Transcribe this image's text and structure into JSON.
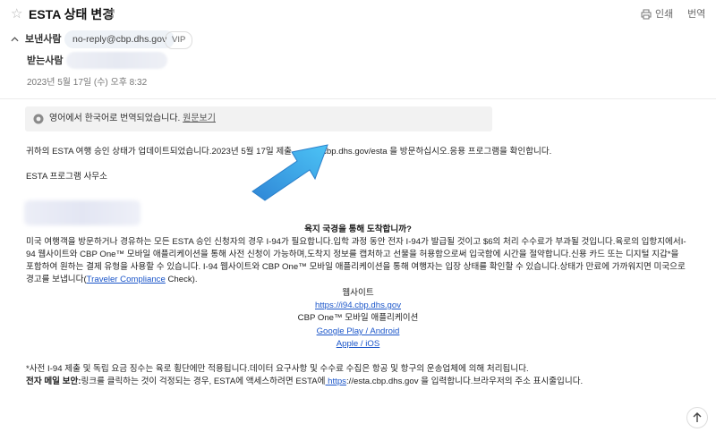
{
  "header": {
    "title": "ESTA 상태 변경",
    "print_label": "인쇄",
    "translate_label": "번역"
  },
  "sender": {
    "label": "보낸사람",
    "email": "no-reply@cbp.dhs.gov",
    "badge": "VIP"
  },
  "recipient": {
    "label": "받는사람"
  },
  "date": "2023년 5월 17일 (수) 오후 8:32",
  "translation_banner": {
    "text": "영어에서 한국어로 번역되었습니다.",
    "link": "원문보기"
  },
  "body": {
    "intro": "귀하의 ESTA 여행 승인 상태가 업데이트되었습니다.2023년 5월 17일 제출 ... esta.cbp.dhs.gov/esta 을 방문하십시오.응용 프로그램을 확인합니다.",
    "signoff": "ESTA 프로그램 사무소",
    "heading": "육지 국경을 통해 도착합니까?",
    "paragraph_line1": "미국 여행객을 방문하거나 경유하는 모든 ESTA 승인 신청자의 경우 I-94가 필요합니다.입학 과정 동안 전자 I-94가 발급될 것이고 $6의 처리 수수료가 부과될 것입니다.육로의 입항지에서I-",
    "paragraph_line2": "94 웹사이트와 CBP One™ 모바일 애플리케이션을 통해 사전 신청이 가능하며,도착지 정보를 캡처하고 선물을 허용함으로써 입국함에 시간을 절약합니다.신용 카드 또는 디지털 지갑*을",
    "paragraph_line3": "포함하여 원하는 결제 유형을 사용할 수 있습니다. I-94 웹사이트와 CBP One™ 모바일 애플리케이션을 통해 여행자는 입장 상태를 확인할 수 있습니다.상태가 만료에 가까워지면 미국으로",
    "paragraph_line4_pre": "경고를 보냅니다(",
    "paragraph_line4_link": "Traveler Compliance",
    "paragraph_line4_post": " Check).",
    "website_label": "웹사이트",
    "website_link": "https://i94.cbp.dhs.gov",
    "app_label": "CBP One™ 모바일 애플리케이션",
    "google_link": "Google Play / Android",
    "apple_link": "Apple / iOS",
    "footnote": "*사전 I-94 제출 및 독립 요금 징수는 육로 횡단에만 적용됩니다.데이터 요구사항 및 수수료 수집은 항공 및 항구의 운송업체에 의해 처리됩니다.",
    "security_bold": "전자 메일 보안:",
    "security_text_pre": "링크를 클릭하는 것이 걱정되는 경우, ESTA에 액세스하려면 ESTA에",
    "security_link": " https",
    "security_text_post": "://esta.cbp.dhs.gov 을 입력합니다.브라우저의 주소 표시줄입니다."
  },
  "colors": {
    "link": "#1a55c9",
    "arrow": "#35a8e8",
    "banner_bg": "#f2f2f2"
  }
}
